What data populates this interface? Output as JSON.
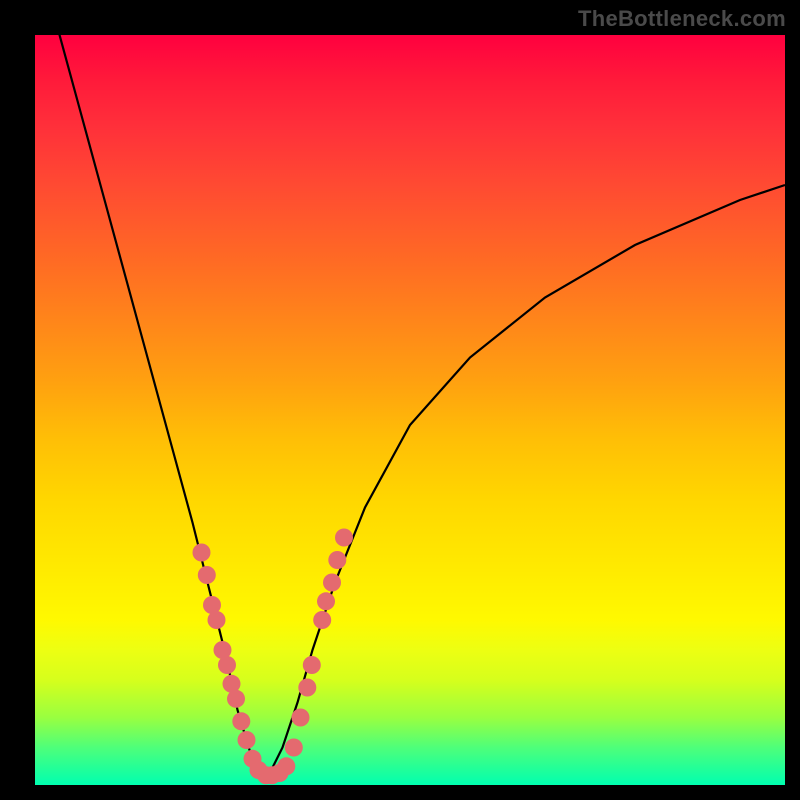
{
  "watermark": "TheBottleneck.com",
  "chart_data": {
    "type": "line",
    "title": "",
    "xlabel": "",
    "ylabel": "",
    "xlim": [
      0,
      100
    ],
    "ylim": [
      0,
      100
    ],
    "grid": false,
    "legend": false,
    "background_colormap": "red-yellow-green vertical gradient",
    "series": [
      {
        "name": "bottleneck-curve",
        "kind": "v-curve",
        "x": [
          3,
          6,
          9,
          12,
          15,
          18,
          21,
          23.5,
          25.5,
          27,
          28.5,
          29.5,
          30.5,
          31.5,
          33,
          35,
          37,
          40,
          44,
          50,
          58,
          68,
          80,
          94,
          100
        ],
        "y": [
          101,
          90,
          79,
          68,
          57,
          46,
          35,
          25,
          17,
          10,
          5,
          2,
          1,
          2,
          5,
          11,
          18,
          27,
          37,
          48,
          57,
          65,
          72,
          78,
          80
        ]
      }
    ],
    "markers": [
      {
        "x": 22.2,
        "y": 31
      },
      {
        "x": 22.9,
        "y": 28
      },
      {
        "x": 23.6,
        "y": 24
      },
      {
        "x": 24.2,
        "y": 22
      },
      {
        "x": 25.0,
        "y": 18
      },
      {
        "x": 25.6,
        "y": 16
      },
      {
        "x": 26.2,
        "y": 13.5
      },
      {
        "x": 26.8,
        "y": 11.5
      },
      {
        "x": 27.5,
        "y": 8.5
      },
      {
        "x": 28.2,
        "y": 6
      },
      {
        "x": 29.0,
        "y": 3.5
      },
      {
        "x": 29.8,
        "y": 2
      },
      {
        "x": 30.8,
        "y": 1.3
      },
      {
        "x": 31.6,
        "y": 1.3
      },
      {
        "x": 32.6,
        "y": 1.6
      },
      {
        "x": 33.5,
        "y": 2.5
      },
      {
        "x": 34.5,
        "y": 5
      },
      {
        "x": 35.4,
        "y": 9
      },
      {
        "x": 36.3,
        "y": 13
      },
      {
        "x": 36.9,
        "y": 16
      },
      {
        "x": 38.3,
        "y": 22
      },
      {
        "x": 38.8,
        "y": 24.5
      },
      {
        "x": 39.6,
        "y": 27
      },
      {
        "x": 40.3,
        "y": 30
      },
      {
        "x": 41.2,
        "y": 33
      }
    ]
  }
}
